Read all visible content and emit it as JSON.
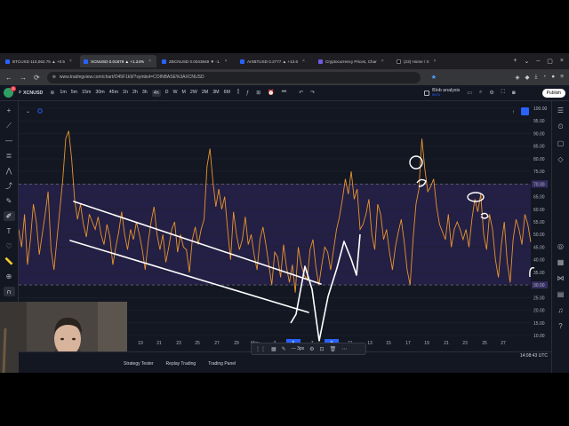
{
  "browser": {
    "tabs": [
      {
        "label": "BTCUSD 110,062.75 ▲ +0.5",
        "active": false
      },
      {
        "label": "XCNUSD 0.01879 ▲ +1.24%",
        "active": true
      },
      {
        "label": "ZBCNUSD 0.0043949 ▼ -1.",
        "active": false
      },
      {
        "label": "AIXBTUSD 0.2777 ▲ +13.6",
        "active": false
      },
      {
        "label": "Cryptocurrency Prices, Char",
        "active": false
      },
      {
        "label": "(23) Home / X",
        "active": false
      }
    ],
    "url": "www.tradingview.com/chart/O45F1k9/?symbol=COINBASE%3AXCNUSD"
  },
  "toolbar": {
    "symbol": "XCNUSD",
    "avatar_badge": "11",
    "intervals": [
      "1m",
      "5m",
      "15m",
      "30m",
      "45m",
      "1h",
      "2h",
      "3h",
      "4h",
      "D",
      "W",
      "M",
      "2W",
      "2M",
      "3M",
      "6M"
    ],
    "active_interval": "4h",
    "blob_label": "Blob analysis",
    "blob_sub": "BETA",
    "publish_label": "Publish"
  },
  "chart_data": {
    "type": "line",
    "x_ticks": [
      "19",
      "21",
      "23",
      "25",
      "27",
      "29",
      "May",
      "3",
      "5",
      "7",
      "9",
      "11",
      "13",
      "15",
      "17",
      "19",
      "21",
      "23",
      "25",
      "27"
    ],
    "highlighted_x_ticks": [
      "5",
      "9"
    ],
    "y_ticks": [
      100.0,
      95.0,
      90.0,
      85.0,
      80.0,
      75.0,
      70.0,
      65.0,
      60.0,
      55.0,
      50.0,
      45.0,
      40.0,
      35.0,
      30.0,
      25.0,
      20.0,
      15.0,
      10.0
    ],
    "ylim": [
      10,
      100
    ],
    "upper_band": 70,
    "lower_band": 30,
    "highlighted_y_ticks": [
      70.0,
      30.0
    ],
    "series": [
      {
        "values": [
          52,
          45,
          58,
          38,
          48,
          62,
          55,
          42,
          50,
          58,
          67,
          44,
          36,
          48,
          60,
          72,
          88,
          91,
          80,
          64,
          56,
          62,
          54,
          49,
          58,
          55,
          52,
          57,
          50,
          46,
          54,
          49,
          38,
          45,
          51,
          59,
          50,
          44,
          52,
          48,
          55,
          50,
          44,
          36,
          47,
          55,
          61,
          50,
          44,
          50,
          39,
          45,
          52,
          55,
          43,
          50,
          45,
          44,
          35,
          48,
          53,
          46,
          52,
          56,
          77,
          84,
          71,
          61,
          68,
          60,
          65,
          52,
          40,
          59,
          50,
          44,
          48,
          57,
          46,
          50,
          42,
          36,
          48,
          53,
          46,
          38,
          30,
          43,
          41,
          33,
          46,
          37,
          31,
          38,
          27,
          45,
          38,
          34,
          32,
          44,
          48,
          37,
          30,
          38,
          45,
          43,
          36,
          44,
          52,
          57,
          64,
          72,
          66,
          75,
          64,
          68,
          52,
          54,
          58,
          64,
          50,
          44,
          62,
          58,
          48,
          52,
          43,
          36,
          45,
          51,
          56,
          47,
          36,
          30,
          48,
          62,
          68,
          88,
          76,
          67,
          69,
          72,
          61,
          54,
          51,
          48,
          58,
          45,
          52,
          55,
          52,
          48,
          52,
          45,
          56,
          64,
          59,
          66,
          50,
          44,
          58,
          52,
          40,
          33,
          46,
          55,
          39,
          31,
          48,
          56,
          52,
          46,
          58,
          54,
          47
        ]
      }
    ],
    "grid": true
  },
  "bottom": {
    "tabs": [
      "Strategy Tester",
      "Replay Trading",
      "Trading Panel"
    ],
    "clock": "14:08:43 UTC",
    "stroke_width": "3px"
  },
  "colors": {
    "background": "#131722",
    "line": "#e8952f",
    "band_fill": "#2b2350",
    "drawing": "#ffffff",
    "accent": "#2962ff"
  }
}
